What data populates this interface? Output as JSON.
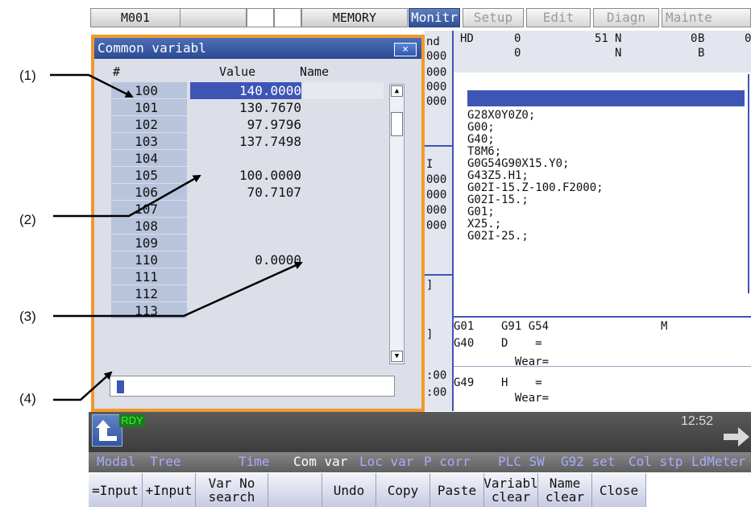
{
  "topbar": {
    "program": "M001",
    "mode": "MEMORY",
    "tabs": [
      "Monitr",
      "Setup",
      "Edit",
      "Diagn",
      "Mainte"
    ]
  },
  "background": {
    "hd_label": "HD",
    "hd_row1": {
      "v1": "0",
      "v2": "51",
      "n": "N",
      "v3": "0",
      "b": "B",
      "v4": "0"
    },
    "hd_row2": {
      "v1": "0",
      "n": "N",
      "b": "B"
    },
    "left_partial": [
      "nd",
      "000",
      "000",
      "000",
      "000",
      "I",
      "000",
      "000",
      "000",
      "000",
      "]",
      "]",
      ":00",
      ":00"
    ],
    "program_lines": [
      "G28X0Y0Z0;",
      "G00;",
      "G40;",
      "T8M6;",
      "G0G54G90X15.Y0;",
      "G43Z5.H1;",
      "G02I-15.Z-100.F2000;",
      "G02I-15.;",
      "G01;",
      "X25.;",
      "G02I-25.;"
    ],
    "modal": {
      "line1": "G01    G91 G54",
      "line2": "G40    D    =",
      "line3": "         Wear=",
      "line4": "G49    H    =",
      "line5": "         Wear=",
      "m_label": "M"
    }
  },
  "dialog": {
    "title": "Common variabl",
    "close_label": "×",
    "col_hash": "#",
    "col_value": "Value",
    "col_name": "Name",
    "rows": [
      {
        "no": "100",
        "value": "140.0000"
      },
      {
        "no": "101",
        "value": "130.7670"
      },
      {
        "no": "102",
        "value": "97.9796"
      },
      {
        "no": "103",
        "value": "137.7498"
      },
      {
        "no": "104",
        "value": ""
      },
      {
        "no": "105",
        "value": "100.0000"
      },
      {
        "no": "106",
        "value": "70.7107"
      },
      {
        "no": "107",
        "value": ""
      },
      {
        "no": "108",
        "value": ""
      },
      {
        "no": "109",
        "value": ""
      },
      {
        "no": "110",
        "value": "0.0000"
      },
      {
        "no": "111",
        "value": ""
      },
      {
        "no": "112",
        "value": ""
      },
      {
        "no": "113",
        "value": ""
      }
    ],
    "input_value": ""
  },
  "callouts": [
    "(1)",
    "(2)",
    "(3)",
    "(4)"
  ],
  "status": {
    "state": "RDY",
    "time": "12:52"
  },
  "menu_row": [
    "Modal",
    "Tree",
    "Time",
    "Com var",
    "Loc var",
    "P corr",
    "PLC SW",
    "G92 set",
    "Col stp",
    "LdMeter"
  ],
  "menu_active": "Com var",
  "function_keys": [
    "=Input",
    "+Input",
    "Var No search",
    "",
    "Undo",
    "Copy",
    "Paste",
    "Variabl clear",
    "Name clear",
    "Close"
  ],
  "colors": {
    "accent_orange": "#f09a2b",
    "title_blue": "#2b4a93",
    "selection_blue": "#3e55b6",
    "status_green": "#2bd62b"
  }
}
